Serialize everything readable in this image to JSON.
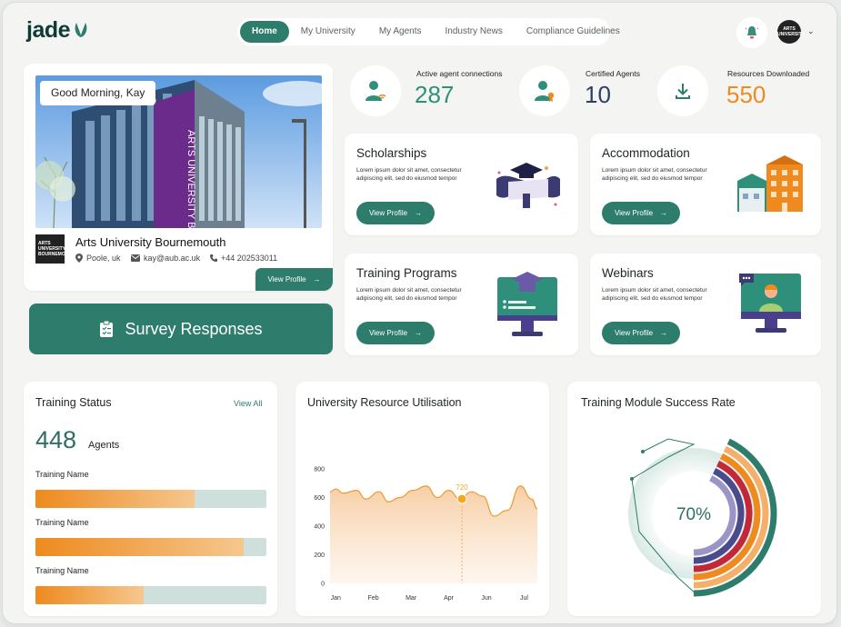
{
  "header": {
    "logo": "jade",
    "nav": [
      "Home",
      "My University",
      "My Agents",
      "Industry News",
      "Compliance Guidelines"
    ],
    "active_nav": "Home",
    "avatar_text": "ARTS UNIVERSITY"
  },
  "profile": {
    "greeting": "Good Morning, Kay",
    "university": "Arts University Bournemouth",
    "logo_text": "ARTS UNIVERSITY BOURNEMOUTH",
    "location": "Poole, uk",
    "email": "kay@aub.ac.uk",
    "phone": "+44 202533011",
    "view_profile": "View Profile"
  },
  "survey_button": "Survey Responses",
  "stats": [
    {
      "label": "Active agent connections",
      "value": "287",
      "color": "#2e8f7a"
    },
    {
      "label": "Certified Agents",
      "value": "10",
      "color": "#2d3f66"
    },
    {
      "label": "Resources Downloaded",
      "value": "550",
      "color": "#ee8a1e"
    }
  ],
  "features": [
    {
      "title": "Scholarships",
      "desc": "Lorem ipsum dolor sit amet, consectetur adipiscing elit, sed do eiusmod tempor",
      "button": "View Profile"
    },
    {
      "title": "Accommodation",
      "desc": "Lorem ipsum dolor sit amet, consectetur adipiscing elit, sed do eiusmod tempor",
      "button": "View Profile"
    },
    {
      "title": "Training Programs",
      "desc": "Lorem ipsum dolor sit amet, consectetur adipiscing elit, sed do eiusmod tempor",
      "button": "View Profile"
    },
    {
      "title": "Webinars",
      "desc": "Lorem ipsum dolor sit amet, consectetur adipiscing elit, sed do eiusmod tempor",
      "button": "View Profile"
    }
  ],
  "training_status": {
    "title": "Training Status",
    "view_all": "View All",
    "count": "448",
    "count_label": "Agents",
    "items": [
      {
        "name": "Training Name",
        "progress": 0.69
      },
      {
        "name": "Training Name",
        "progress": 0.9
      },
      {
        "name": "Training Name",
        "progress": 0.47
      }
    ]
  },
  "resource_chart": {
    "title": "University Resource Utilisation",
    "highlight_label": "720"
  },
  "chart_data": {
    "type": "area",
    "x": [
      "Jan",
      "Feb",
      "Mar",
      "Apr",
      "Jun",
      "Jul"
    ],
    "y_ticks": [
      0,
      200,
      400,
      600,
      800
    ],
    "ylim": [
      0,
      800
    ],
    "series_points": [
      [
        0.0,
        640
      ],
      [
        0.15,
        660
      ],
      [
        0.35,
        630
      ],
      [
        0.7,
        650
      ],
      [
        0.95,
        590
      ],
      [
        1.3,
        640
      ],
      [
        1.55,
        570
      ],
      [
        1.85,
        600
      ],
      [
        2.2,
        650
      ],
      [
        2.55,
        680
      ],
      [
        2.85,
        600
      ],
      [
        3.15,
        650
      ],
      [
        3.45,
        590
      ],
      [
        3.75,
        640
      ],
      [
        4.05,
        610
      ],
      [
        4.35,
        470
      ],
      [
        4.7,
        510
      ],
      [
        5.05,
        680
      ],
      [
        5.35,
        590
      ],
      [
        5.5,
        520
      ]
    ],
    "highlight_point": {
      "x": 3.5,
      "y": 590,
      "label": "720"
    },
    "grid": false
  },
  "success_rate": {
    "title": "Training Module Success Rate",
    "value": "70%",
    "arcs": [
      {
        "color": "#2e7d6c"
      },
      {
        "color": "#f4b06b"
      },
      {
        "color": "#ee8a1e"
      },
      {
        "color": "#c2273a"
      },
      {
        "color": "#4a4b8c"
      },
      {
        "color": "#9b94c6"
      }
    ]
  }
}
